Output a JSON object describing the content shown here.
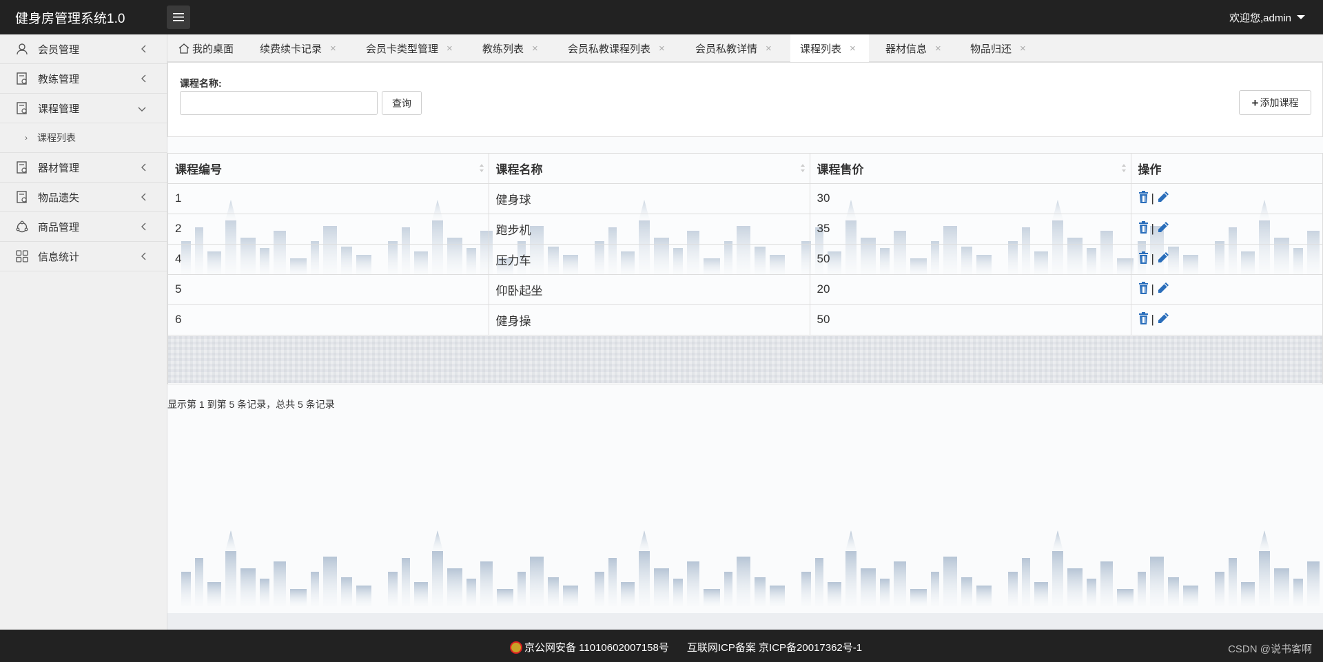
{
  "header": {
    "app_title": "健身房管理系统1.0",
    "welcome": "欢迎您,admin"
  },
  "sidebar": {
    "items": [
      {
        "label": "会员管理",
        "icon": "user-icon",
        "expanded": false
      },
      {
        "label": "教练管理",
        "icon": "document-icon",
        "expanded": false
      },
      {
        "label": "课程管理",
        "icon": "document-icon",
        "expanded": true,
        "children": [
          {
            "label": "课程列表"
          }
        ]
      },
      {
        "label": "器材管理",
        "icon": "document-icon",
        "expanded": false
      },
      {
        "label": "物品遗失",
        "icon": "document-icon",
        "expanded": false
      },
      {
        "label": "商品管理",
        "icon": "cycle-icon",
        "expanded": false
      },
      {
        "label": "信息统计",
        "icon": "grid-icon",
        "expanded": false
      }
    ]
  },
  "tabs": [
    {
      "label": "我的桌面",
      "home": true
    },
    {
      "label": "续费续卡记录"
    },
    {
      "label": "会员卡类型管理"
    },
    {
      "label": "教练列表"
    },
    {
      "label": "会员私教课程列表"
    },
    {
      "label": "会员私教详情"
    },
    {
      "label": "课程列表",
      "active": true
    },
    {
      "label": "器材信息"
    },
    {
      "label": "物品归还"
    }
  ],
  "search": {
    "label": "课程名称:",
    "value": "",
    "placeholder": "",
    "query_button": "查询",
    "add_button": "添加课程"
  },
  "table": {
    "headers": [
      "课程编号",
      "课程名称",
      "课程售价",
      "操作"
    ],
    "rows": [
      {
        "id": "1",
        "name": "健身球",
        "price": "30"
      },
      {
        "id": "2",
        "name": "跑步机",
        "price": "35"
      },
      {
        "id": "4",
        "name": "压力车",
        "price": "50"
      },
      {
        "id": "5",
        "name": "仰卧起坐",
        "price": "20"
      },
      {
        "id": "6",
        "name": "健身操",
        "price": "50"
      }
    ],
    "op_separator": "|"
  },
  "pagination": {
    "info": "显示第 1 到第 5 条记录，总共 5 条记录"
  },
  "footer": {
    "police_record": "京公网安备 11010602007158号",
    "icp_record": "互联网ICP备案 京ICP备20017362号-1",
    "watermark": "CSDN @说书客啊"
  },
  "colors": {
    "topbar": "#222222",
    "sidebar_bg": "#f0f0f0",
    "icon_blue": "#2a6ebb"
  }
}
